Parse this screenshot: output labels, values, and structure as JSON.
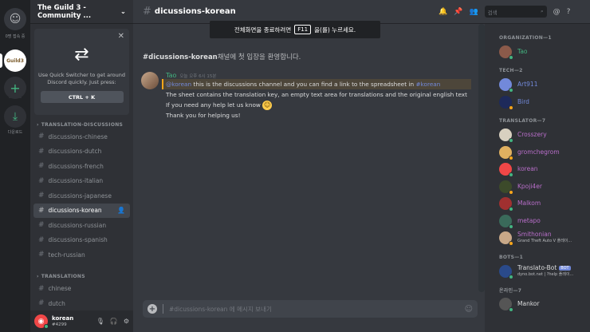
{
  "colors": {
    "accent": "#7289da",
    "online": "#43b581",
    "idle": "#faa61a",
    "dnd": "#f04747"
  },
  "rail": {
    "home_label": "0명 접속 중",
    "guild_badge": "Guild3",
    "download_label": "다운로드"
  },
  "sidebar": {
    "server_name": "The Guild 3 - Community ...",
    "quick_switcher": {
      "text": "Use Quick Switcher to get around Discord quickly. Just press:",
      "shortcut": "CTRL + K"
    },
    "categories": [
      {
        "label": "TRANSLATION-DISCUSSIONS",
        "channels": [
          "discussions-chinese",
          "discussions-dutch",
          "discussions-french",
          "discussions-italian",
          "discussions-japanese",
          "dicussions-korean",
          "discussions-russian",
          "discussions-spanish",
          "tech-russian"
        ]
      },
      {
        "label": "TRANSLATIONS",
        "channels": [
          "chinese",
          "dutch"
        ]
      }
    ],
    "active_channel": "dicussions-korean",
    "user": {
      "name": "korean",
      "discriminator": "#4299"
    }
  },
  "header": {
    "channel": "dicussions-korean",
    "search_placeholder": "검색"
  },
  "fullscreen_banner": {
    "before": "전체화면을 종료하려면",
    "key": "F11",
    "after": "을(를) 누르세요."
  },
  "chat": {
    "welcome_channel": "#dicussions-korean",
    "welcome_suffix": "채널에 첫 입장을 환영합니다.",
    "message": {
      "author": "Tao",
      "timestamp": "오늘 오후 6시 15분",
      "line1_mention": "@korean",
      "line1_text": " this is the discussions channel and you can find a link to the spreadsheet in ",
      "line1_channel": "#korean",
      "line2": "The sheet contains the translation key, an empty text area for translations and the original english text",
      "line3": "If you need any help let us know",
      "line4": "Thank you for helping us!"
    },
    "composer_placeholder": "#dicussions-korean 에 메시지 보내기"
  },
  "members": {
    "groups": [
      {
        "label": "ORGANIZATION—1",
        "items": [
          {
            "name": "Tao",
            "color": "#43b581",
            "avatar": "#8b5a4a",
            "status": "#43b581"
          }
        ]
      },
      {
        "label": "TECH—2",
        "items": [
          {
            "name": "Art911",
            "color": "#7289da",
            "avatar": "#7289da",
            "status": "#43b581"
          },
          {
            "name": "Bird",
            "color": "#7289da",
            "avatar": "#1e2a5a",
            "status": "#faa61a"
          }
        ]
      },
      {
        "label": "TRANSLATOR—7",
        "items": [
          {
            "name": "Crosszery",
            "color": "#b86ec9",
            "avatar": "#d8d0c0",
            "status": "#43b581"
          },
          {
            "name": "gromchegrom",
            "color": "#b86ec9",
            "avatar": "#e0b060",
            "status": "#faa61a"
          },
          {
            "name": "korean",
            "color": "#b86ec9",
            "avatar": "#f04747",
            "status": "#43b581"
          },
          {
            "name": "Kpoji4er",
            "color": "#b86ec9",
            "avatar": "#3c4a2a",
            "status": "#faa61a"
          },
          {
            "name": "Malkom",
            "color": "#b86ec9",
            "avatar": "#a03030",
            "status": "#43b581"
          },
          {
            "name": "metapo",
            "color": "#b86ec9",
            "avatar": "#3a6a5a",
            "status": "#43b581"
          },
          {
            "name": "Smithonian",
            "color": "#b86ec9",
            "avatar": "#c8a888",
            "status": "#faa61a",
            "sub": "Grand Theft Auto V 플레이..."
          }
        ]
      },
      {
        "label": "BOTS—1",
        "items": [
          {
            "name": "Translato-Bot",
            "color": "#dcddde",
            "avatar": "#2a4a8a",
            "status": "#43b581",
            "bot": "BOT",
            "sub": "dyno.bot.net | ?help 플레이..."
          }
        ]
      },
      {
        "label": "온라인—7",
        "items": [
          {
            "name": "Mankor",
            "color": "#dcddde",
            "avatar": "#555",
            "status": "#43b581"
          }
        ]
      }
    ]
  }
}
